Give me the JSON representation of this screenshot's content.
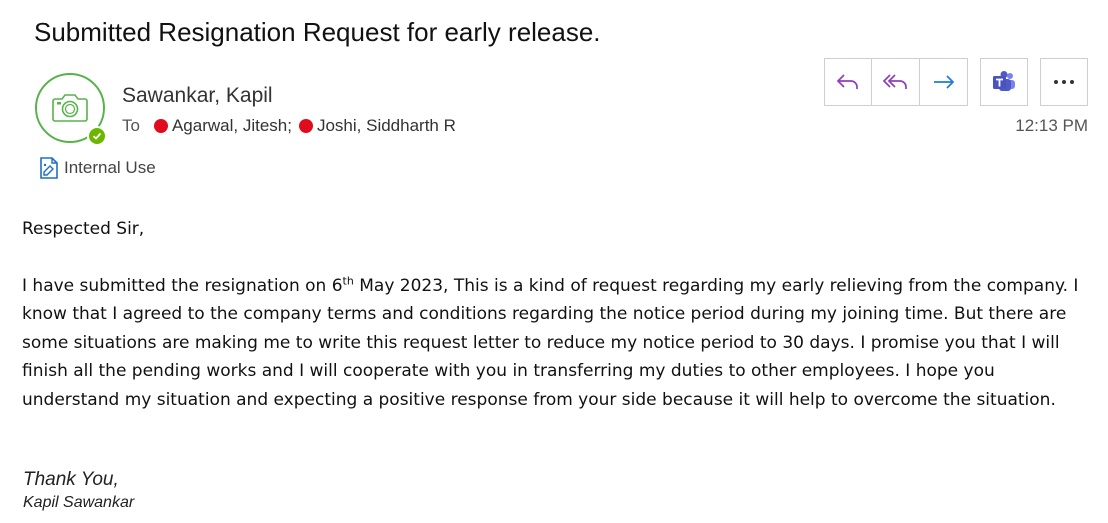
{
  "email": {
    "subject": "Submitted Resignation Request for early release.",
    "sender": "Sawankar, Kapil",
    "to_label": "To",
    "recipients": [
      {
        "name": "Agarwal, Jitesh;",
        "status_color": "#e00b1c"
      },
      {
        "name": "Joshi, Siddharth R",
        "status_color": "#e00b1c"
      }
    ],
    "sensitivity_label": "Internal Use",
    "time": "12:13 PM",
    "presence_color": "#6bb700"
  },
  "toolbar": {
    "reply_icon": "reply-icon",
    "reply_all_icon": "reply-all-icon",
    "forward_icon": "forward-icon",
    "teams_icon": "teams-icon",
    "more_icon": "more-icon"
  },
  "body": {
    "greeting": "Respected Sir,",
    "para_before_sup": "I have submitted the resignation on 6",
    "sup": "th",
    "para_after_sup": " May 2023, This is a kind of request regarding my early relieving from the company. I know that I agreed to the company terms and conditions regarding the notice period during my joining time. But there are some situations are making me to write this request letter to reduce my notice period to 30 days. I promise you that I will finish all the pending works and I will cooperate with you in transferring my duties to other employees. I hope you understand my situation and expecting a positive response from your side because it will help to overcome the situation.",
    "closing": "Thank You,",
    "signature": "Kapil Sawankar"
  }
}
